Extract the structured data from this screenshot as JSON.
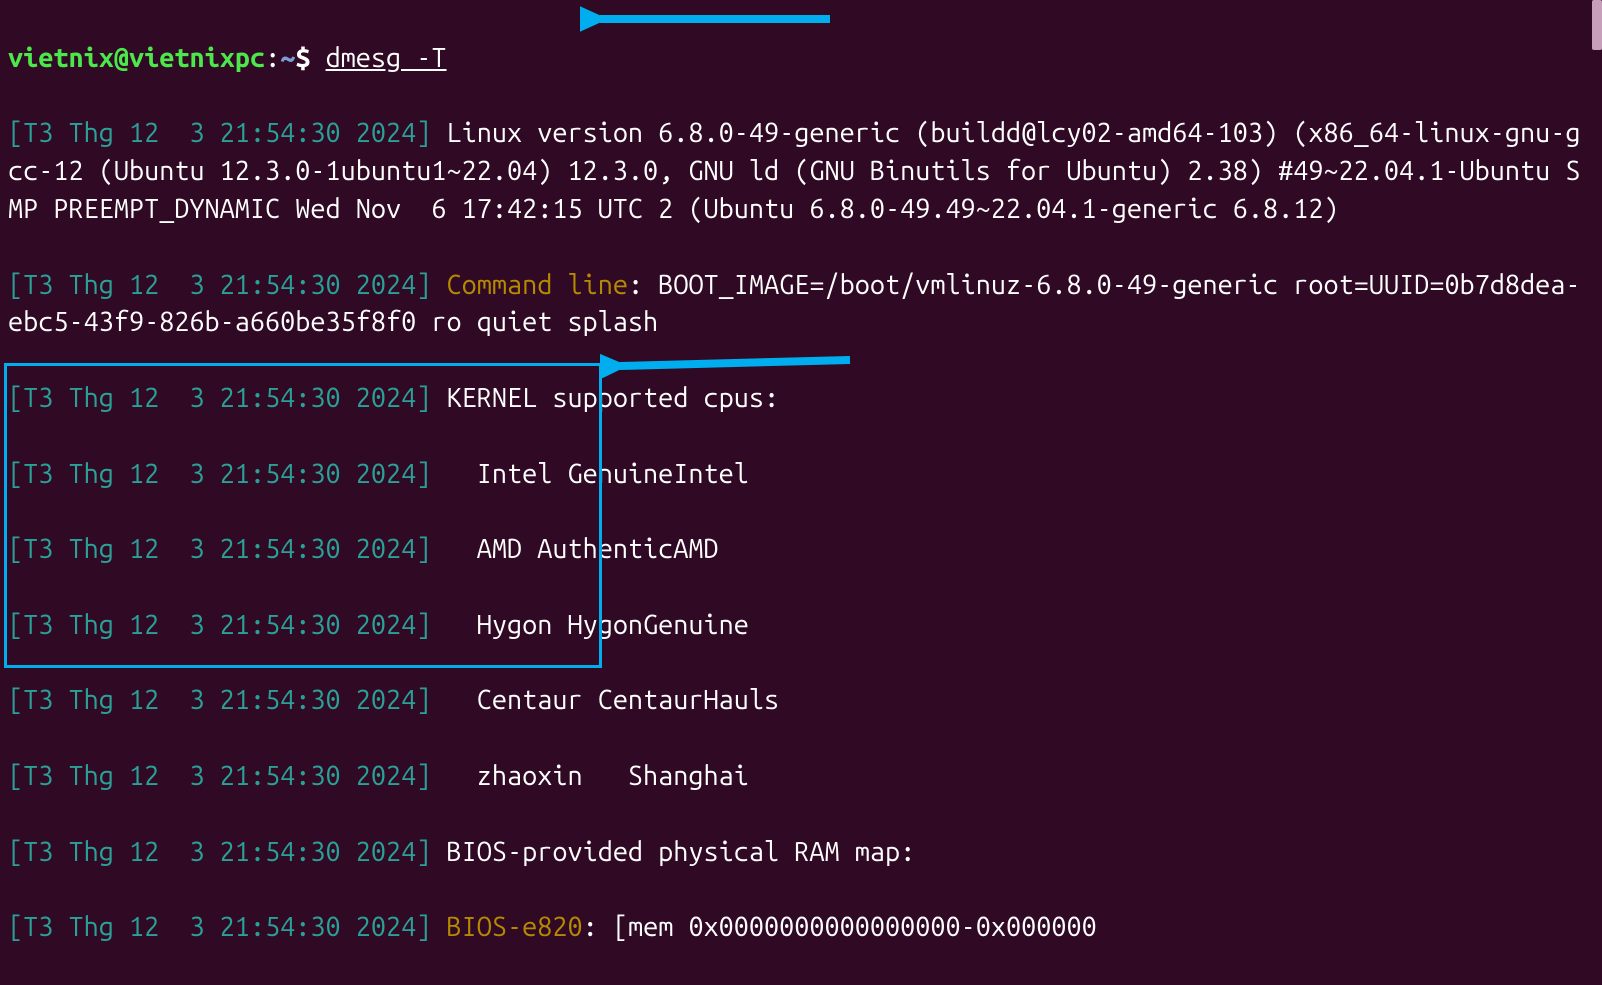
{
  "prompt": {
    "user": "vietnix",
    "at": "@",
    "host": "vietnixpc",
    "colon": ":",
    "path": "~",
    "dollar": "$ ",
    "command": "dmesg -T"
  },
  "lines": {
    "ts": "[T3 Thg 12  3 21:54:30 2024]",
    "l1": " Linux version 6.8.0-49-generic (buildd@lcy02-amd64-103) (x86_64-linux-gnu-gcc-12 (Ubuntu 12.3.0-1ubuntu1~22.04) 12.3.0, GNU ld (GNU Binutils for Ubuntu) 2.38) #49~22.04.1-Ubuntu SMP PREEMPT_DYNAMIC Wed Nov  6 17:42:15 UTC 2 (Ubuntu 6.8.0-49.49~22.04.1-generic 6.8.12)",
    "l2_label": "Command line",
    "l2_colon": ": ",
    "l2_rest": "BOOT_IMAGE=/boot/vmlinuz-6.8.0-49-generic root=UUID=0b7d8dea-ebc5-43f9-826b-a660be35f8f0 ro quiet splash",
    "l3": " KERNEL supported cpus:",
    "l4": "   Intel GenuineIntel",
    "l5": "   AMD AuthenticAMD",
    "l6": "   Hygon HygonGenuine",
    "l7": "   Centaur CentaurHauls",
    "l8": "   zhaoxin   Shanghai",
    "l9": " BIOS-provided physical RAM map:",
    "l10_label": "BIOS-e820",
    "l10_colon": ": ",
    "l10_rest": "[mem 0x0000000000000000-0x000000"
  }
}
